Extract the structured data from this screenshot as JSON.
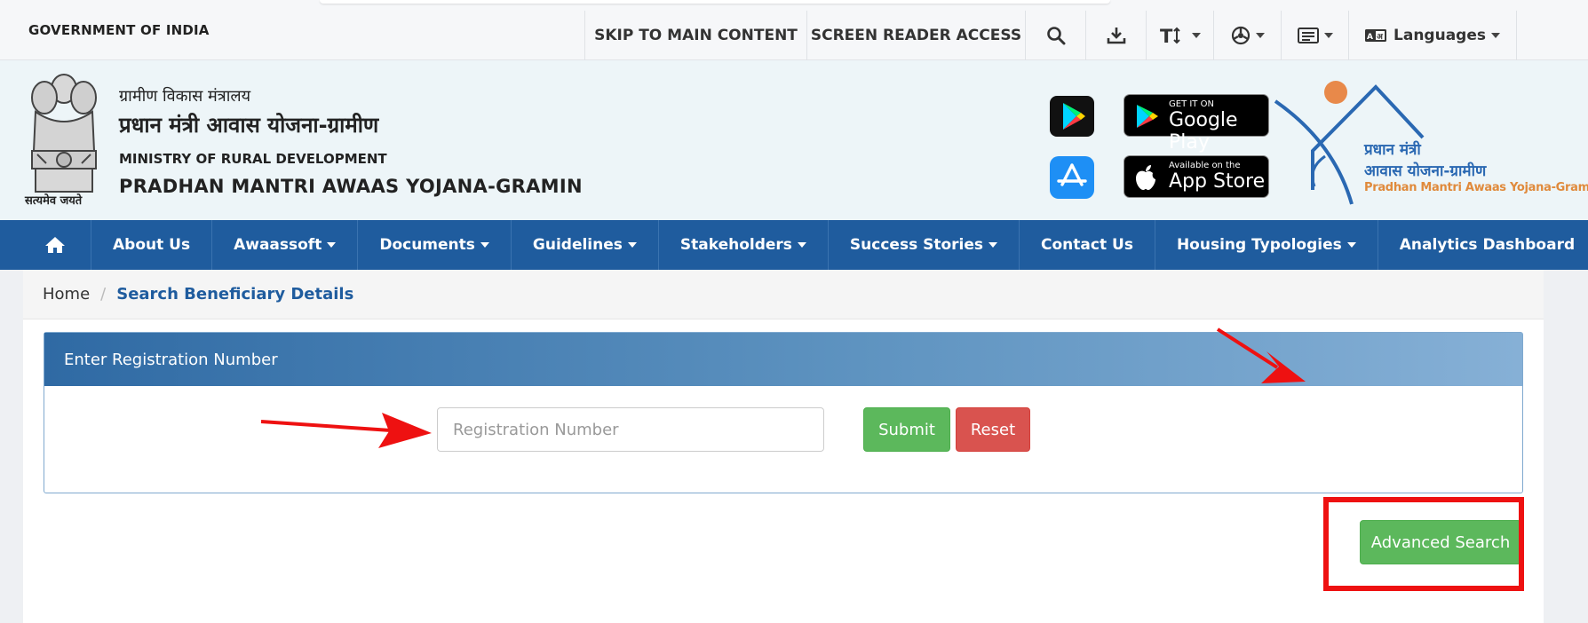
{
  "topbar": {
    "gov_label": "GOVERNMENT OF INDIA",
    "skip": "SKIP TO MAIN CONTENT",
    "screen_reader": "SCREEN READER ACCESS",
    "languages": "Languages",
    "icons": [
      "search-icon",
      "download-icon",
      "text-size-icon",
      "contrast-icon",
      "sitemap-icon",
      "language-icon"
    ]
  },
  "header": {
    "emblem_motto": "सत्यमेव जयते",
    "ministry_hi": "ग्रामीण विकास मंत्रालय",
    "scheme_hi": "प्रधान मंत्री आवास योजना-ग्रामीण",
    "ministry_en": "MINISTRY OF RURAL DEVELOPMENT",
    "scheme_en": "PRADHAN MANTRI AWAAS YOJANA-GRAMIN",
    "google_play_small": "GET IT ON",
    "google_play_big": "Google Play",
    "app_store_small": "Available on the",
    "app_store_big": "App Store",
    "logo_line1": "प्रधान मंत्री",
    "logo_line2": "आवास योजना-ग्रामीण",
    "logo_line3": "Pradhan Mantri Awaas Yojana-Gramin"
  },
  "nav": {
    "items": [
      {
        "label": "About Us"
      },
      {
        "label": "Awaassoft"
      },
      {
        "label": "Documents"
      },
      {
        "label": "Guidelines"
      },
      {
        "label": "Stakeholders"
      },
      {
        "label": "Success Stories"
      },
      {
        "label": "Contact Us"
      },
      {
        "label": "Housing Typologies"
      },
      {
        "label": "Analytics Dashboard"
      }
    ]
  },
  "breadcrumb": {
    "home": "Home",
    "separator": "/",
    "current": "Search Beneficiary Details"
  },
  "panel": {
    "title": "Enter Registration Number",
    "input_value": "",
    "input_placeholder": "Registration Number",
    "submit": "Submit",
    "reset": "Reset"
  },
  "advanced_search": "Advanced Search",
  "colors": {
    "nav_blue": "#1f5c9e",
    "success_green": "#5cb85c",
    "danger_red": "#d9534f",
    "annotation_red": "#ee1111"
  }
}
